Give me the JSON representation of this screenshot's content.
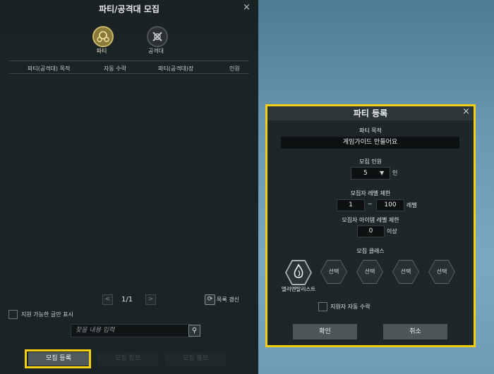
{
  "recruit_window": {
    "title": "파티/공격대 모집",
    "close_glyph": "×",
    "tabs": [
      {
        "label": "파티",
        "icon": "party-emblem-icon",
        "selected": true
      },
      {
        "label": "공격대",
        "icon": "raid-emblem-icon",
        "selected": false
      }
    ],
    "columns": [
      "파티(공격대) 목적",
      "자동 수락",
      "파티(공격대)장",
      "인원"
    ],
    "rows": [],
    "pager": {
      "prev": "<",
      "page_text": "1/1",
      "next": ">"
    },
    "refresh_label": "목록 갱신",
    "filter_label": "지원 가능한 글만 표시",
    "search_placeholder": "찾을 내용 입력",
    "bottom_buttons": [
      "모집 등록",
      "모집 정보",
      "모집 홍보"
    ]
  },
  "party_register_dialog": {
    "title": "파티 등록",
    "close_glyph": "×",
    "purpose_label": "파티 목적",
    "purpose_value": "게임가이드 만들어요",
    "count_label": "모집 인원",
    "count_value": "5",
    "count_unit": "인",
    "level_label": "모집자 레벨 제한",
    "level_min": "1",
    "level_sep": "~",
    "level_max": "100",
    "level_unit": "레벨",
    "item_level_label": "모집자 아이템 레벨 제한",
    "item_level_value": "0",
    "item_level_unit": "이상",
    "class_label": "모집 클래스",
    "classes": [
      {
        "label": "엘리멘탈리스트",
        "icon": "elementalist-class-icon"
      },
      {
        "label": "선택"
      },
      {
        "label": "선택"
      },
      {
        "label": "선택"
      },
      {
        "label": "선택"
      }
    ],
    "auto_accept_label": "지원자 자동 수락",
    "confirm_label": "확인",
    "cancel_label": "취소"
  },
  "highlight_color": "#f5cf0c"
}
